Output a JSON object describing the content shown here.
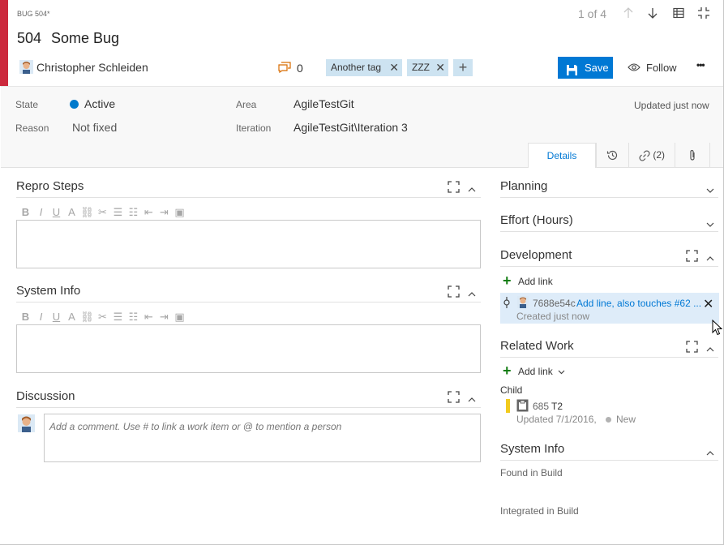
{
  "header": {
    "work_item_type": "BUG 504*",
    "id": "504",
    "title": "Some Bug",
    "pager": "1 of 4",
    "assigned_to": "Christopher Schleiden",
    "comment_count": "0",
    "tags": [
      "Another tag",
      "ZZZ"
    ],
    "save_label": "Save",
    "follow_label": "Follow",
    "more_label": "•••",
    "accent_color": "#cc293d",
    "save_color": "#0078d4"
  },
  "fields": {
    "state_label": "State",
    "state_value": "Active",
    "state_color": "#007acc",
    "reason_label": "Reason",
    "reason_value": "Not fixed",
    "area_label": "Area",
    "area_value": "AgileTestGit",
    "iteration_label": "Iteration",
    "iteration_value": "AgileTestGit\\Iteration 3",
    "updated": "Updated just now"
  },
  "tabs": {
    "details": "Details",
    "links_count": "(2)"
  },
  "left": {
    "repro_title": "Repro Steps",
    "system_info_title": "System Info",
    "discussion_title": "Discussion",
    "comment_placeholder": "Add a comment. Use # to link a work item or @ to mention a person"
  },
  "right": {
    "planning_title": "Planning",
    "effort_title": "Effort (Hours)",
    "development_title": "Development",
    "add_link_label": "Add link",
    "commit_hash": "7688e54c",
    "commit_message": "Add line, also touches #62 ...",
    "commit_created": "Created just now",
    "related_title": "Related Work",
    "related_add_link": "Add link",
    "child_label": "Child",
    "child_id": "685",
    "child_title": "T2",
    "child_updated": "Updated 7/1/2016,",
    "child_state": "New",
    "child_color": "#f2cb1d",
    "system_info_title": "System Info",
    "found_in_build": "Found in Build",
    "integrated_in_build": "Integrated in Build"
  }
}
